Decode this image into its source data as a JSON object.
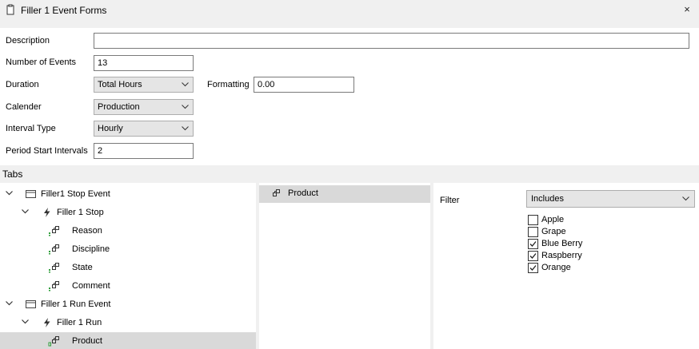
{
  "window": {
    "title": "Filler 1 Event Forms",
    "close_glyph": "×",
    "icon": "document-icon"
  },
  "form": {
    "description_label": "Description",
    "description_value": "",
    "events_label": "Number of Events",
    "events_value": "13",
    "duration_label": "Duration",
    "duration_value": "Total Hours",
    "formatting_label": "Formatting",
    "formatting_value": "0.00",
    "calendar_label": "Calender",
    "calendar_value": "Production",
    "interval_label": "Interval Type",
    "interval_value": "Hourly",
    "period_label": "Period Start Intervals",
    "period_value": "2"
  },
  "tabs_title": "Tabs",
  "tree": [
    {
      "label": "Filler1 Stop Event",
      "icon": "form-icon",
      "expanded": true,
      "level": 0
    },
    {
      "label": "Filler 1 Stop",
      "icon": "lightning-icon",
      "expanded": true,
      "level": 1
    },
    {
      "label": "Reason",
      "icon": "field-icon",
      "level": 2
    },
    {
      "label": "Discipline",
      "icon": "field-icon",
      "level": 2
    },
    {
      "label": "State",
      "icon": "field-icon",
      "level": 2
    },
    {
      "label": "Comment",
      "icon": "field-icon",
      "level": 2
    },
    {
      "label": "Filler 1 Run Event",
      "icon": "form-icon",
      "expanded": true,
      "level": 0
    },
    {
      "label": "Filler 1 Run",
      "icon": "lightning-icon",
      "expanded": true,
      "level": 1
    },
    {
      "label": "Product",
      "icon": "field-filter-icon",
      "level": 2,
      "selected": true
    }
  ],
  "selected_fields": [
    {
      "label": "Product",
      "icon": "field-icon"
    }
  ],
  "filter": {
    "label": "Filter",
    "mode": "Includes",
    "options": [
      {
        "label": "Apple",
        "checked": false
      },
      {
        "label": "Grape",
        "checked": false
      },
      {
        "label": "Blue Berry",
        "checked": true
      },
      {
        "label": "Raspberry",
        "checked": true
      },
      {
        "label": "Orange",
        "checked": true
      }
    ]
  },
  "colors": {
    "field_icon_accent": "#2e9e3a",
    "selection": "#d9d9d9",
    "window_bg": "#f0f0f0"
  }
}
